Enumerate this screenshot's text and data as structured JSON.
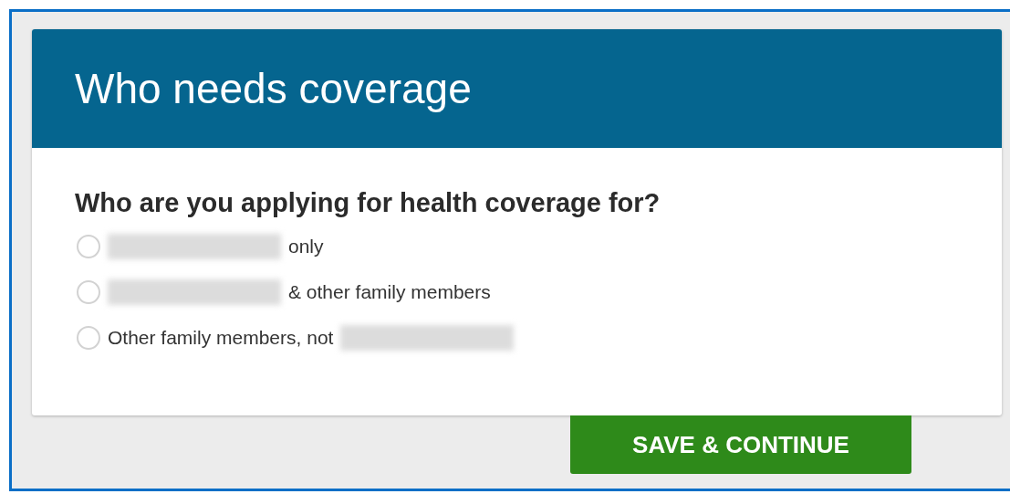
{
  "card": {
    "title": "Who needs coverage",
    "question": "Who are you applying for health coverage for?",
    "options": [
      {
        "selected": false,
        "parts": [
          {
            "kind": "redacted"
          },
          {
            "kind": "text",
            "text": "only"
          }
        ]
      },
      {
        "selected": false,
        "parts": [
          {
            "kind": "redacted"
          },
          {
            "kind": "text",
            "text": "& other family members"
          }
        ]
      },
      {
        "selected": false,
        "parts": [
          {
            "kind": "text",
            "text": "Other family members, not"
          },
          {
            "kind": "redacted"
          }
        ]
      }
    ]
  },
  "button": {
    "label": "SAVE & CONTINUE"
  }
}
